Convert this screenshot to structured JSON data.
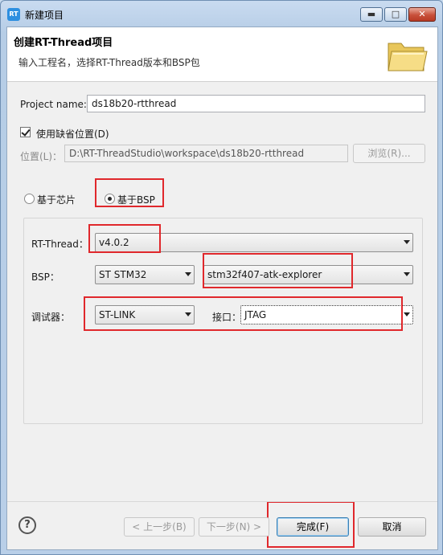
{
  "window": {
    "title": "新建项目",
    "app_icon_text": "RT",
    "min_glyph": "▬",
    "max_glyph": "□",
    "close_glyph": "✕"
  },
  "header": {
    "title": "创建RT-Thread项目",
    "description": "输入工程名，选择RT-Thread版本和BSP包",
    "icon": "folder-open-icon"
  },
  "project": {
    "name_label": "Project name:",
    "name_value": "ds18b20-rtthread",
    "default_location_label": "使用缺省位置(D)",
    "default_location_checked": true,
    "location_label": "位置(L)：",
    "location_value": "D:\\RT-ThreadStudio\\workspace\\ds18b20-rtthread",
    "browse_label": "浏览(R)..."
  },
  "based_on": {
    "chip_label": "基于芯片",
    "bsp_label": "基于BSP",
    "selected": "bsp"
  },
  "config": {
    "rtthread_label": "RT-Thread：",
    "rtthread_value": "v4.0.2",
    "bsp_label": "BSP：",
    "bsp_vendor_value": "ST STM32",
    "bsp_board_value": "stm32f407-atk-explorer",
    "debugger_label": "调试器：",
    "debugger_value": "ST-LINK",
    "interface_label": "接口：",
    "interface_value": "JTAG"
  },
  "footer": {
    "help_glyph": "?",
    "back_label": "< 上一步(B)",
    "next_label": "下一步(N) >",
    "finish_label": "完成(F)",
    "cancel_label": "取消"
  },
  "colors": {
    "highlight_box": "#e0282c",
    "window_frame": "#b9cfe8",
    "client_bg": "#f0f0f0"
  }
}
